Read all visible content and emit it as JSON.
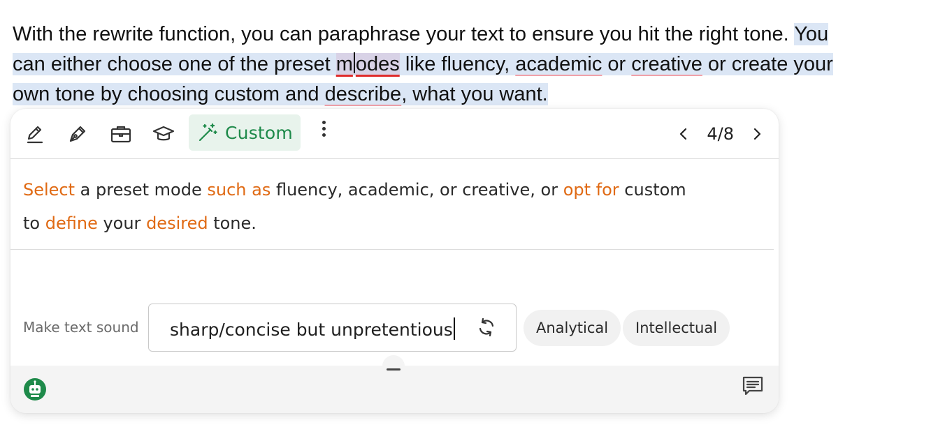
{
  "document": {
    "segments": [
      "With the rewrite function, you can paraphrase your text to ensure you hit the right tone. ",
      "You",
      "can either choose one of the preset ",
      "m",
      "odes",
      " like fluency, ",
      "academic",
      " or ",
      "creative",
      " or create your",
      "own tone by choosing custom and ",
      "describe",
      ", what you want."
    ]
  },
  "toolbar": {
    "icons": [
      "pencil-line-icon",
      "pen-nib-icon",
      "briefcase-icon",
      "graduation-cap-icon",
      "magic-wand-icon",
      "more-vertical-icon"
    ],
    "custom_label": "Custom",
    "pager": "4/8"
  },
  "suggestion": {
    "segments": [
      {
        "text": "Select",
        "changed": true
      },
      {
        "text": " a preset mode ",
        "changed": false
      },
      {
        "text": "such as",
        "changed": true
      },
      {
        "text": " fluency, academic, or creative, or ",
        "changed": false
      },
      {
        "text": "opt for",
        "changed": true
      },
      {
        "text": " custom",
        "changed": false
      },
      {
        "text": "to ",
        "changed": false
      },
      {
        "text": "define",
        "changed": true
      },
      {
        "text": " your ",
        "changed": false
      },
      {
        "text": "desired",
        "changed": true
      },
      {
        "text": " tone.",
        "changed": false
      }
    ]
  },
  "tone": {
    "label": "Make text sound",
    "value": "sharp/concise but unpretentious",
    "chips": [
      "Analytical",
      "Intellectual"
    ]
  },
  "colors": {
    "accent_green": "#1e8a4a",
    "change_orange": "#e06a14",
    "selection_blue": "#dbe6f5"
  }
}
